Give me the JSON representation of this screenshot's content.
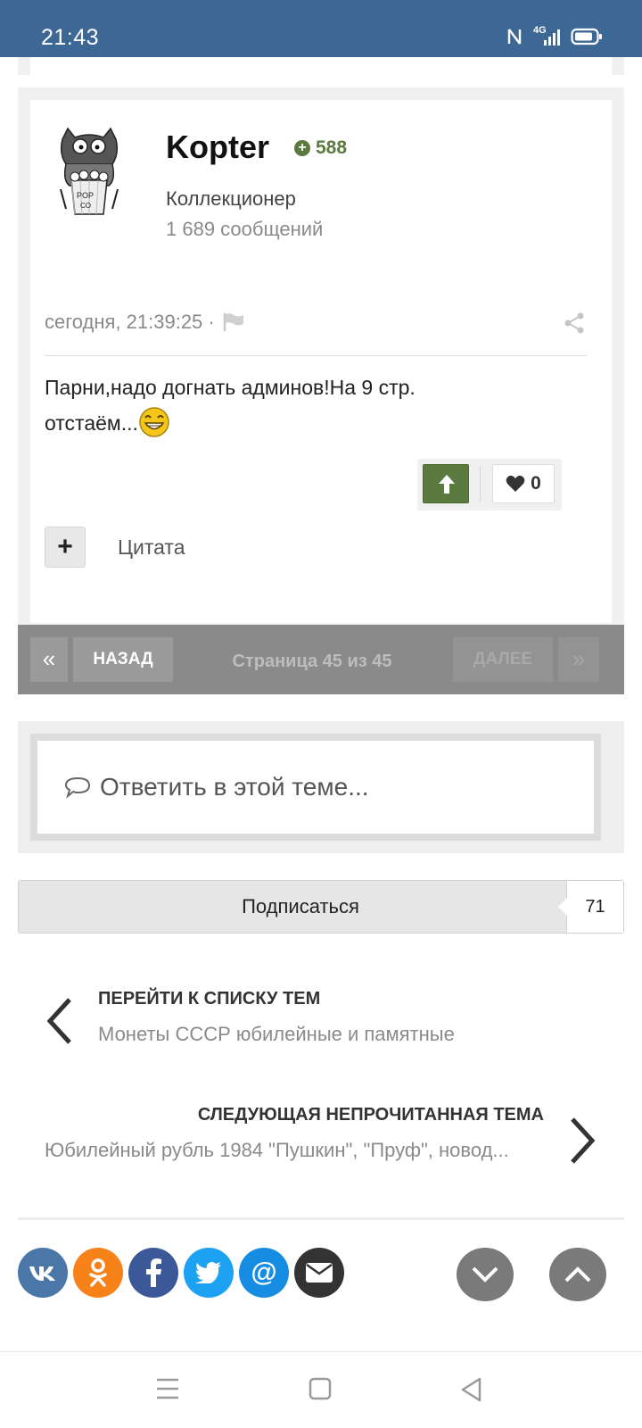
{
  "status_bar": {
    "time": "21:43",
    "network": "4G"
  },
  "post": {
    "author": "Kopter",
    "reputation": "588",
    "rank": "Коллекционер",
    "post_count": "1 689 сообщений",
    "date": "сегодня, 21:39:25 ·",
    "text_line1": "Парни,надо догнать админов!На 9 стр.",
    "text_line2": "отстаём...",
    "likes": "0",
    "quote_label": "Цитата"
  },
  "pager": {
    "first": "«",
    "prev": "НАЗАД",
    "info": "Страница 45 из 45",
    "next": "ДАЛЕЕ",
    "last": "»"
  },
  "reply": {
    "placeholder": "Ответить в этой теме..."
  },
  "subscribe": {
    "label": "Подписаться",
    "count": "71"
  },
  "topic_nav": {
    "prev_title": "ПЕРЕЙТИ К СПИСКУ ТЕМ",
    "prev_sub": "Монеты СССР юбилейные и памятные",
    "next_title": "СЛЕДУЮЩАЯ НЕПРОЧИТАННАЯ ТЕМА",
    "next_sub": "Юбилейный рубль 1984 \"Пушкин\", \"Пруф\", новод..."
  },
  "social": [
    {
      "name": "vk",
      "label": "vk",
      "color": "#4a76a8"
    },
    {
      "name": "odnoklassniki",
      "label": "ok",
      "color": "#f7821a"
    },
    {
      "name": "facebook",
      "label": "f",
      "color": "#3b5998"
    },
    {
      "name": "twitter",
      "label": "t",
      "color": "#1da1f2"
    },
    {
      "name": "mail",
      "label": "@",
      "color": "#168de2"
    },
    {
      "name": "email",
      "label": "✉",
      "color": "#333333"
    }
  ],
  "colors": {
    "header": "#3d6896",
    "accent_green": "#5a7a3f",
    "pager_bg": "#8a8a8a"
  }
}
